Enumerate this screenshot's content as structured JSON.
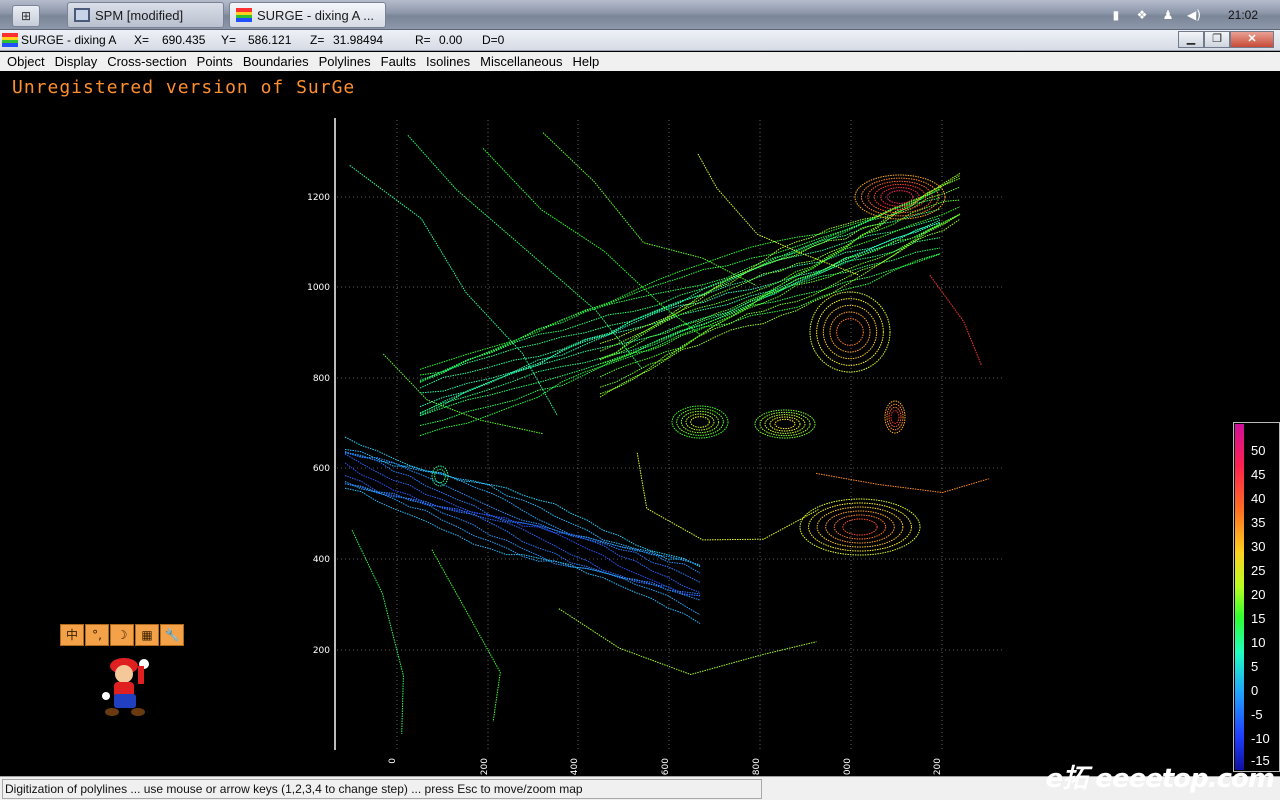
{
  "taskbar": {
    "tasks": [
      {
        "label": "SPM [modified]",
        "active": false
      },
      {
        "label": "SURGE - dixing A  ...",
        "active": true
      }
    ],
    "clock": "21:02"
  },
  "titlebar": {
    "app_name": "SURGE - dixing A",
    "x_label": "X=",
    "x_value": "690.435",
    "y_label": "Y=",
    "y_value": "586.121",
    "z_label": "Z=",
    "z_value": "31.98494",
    "r_label": "R=",
    "r_value": "0.00",
    "d_label": "D=0"
  },
  "menu": [
    "Object",
    "Display",
    "Cross-section",
    "Points",
    "Boundaries",
    "Polylines",
    "Faults",
    "Isolines",
    "Miscellaneous",
    "Help"
  ],
  "banner": "Unregistered version of SurGe",
  "axes": {
    "y_ticks": [
      "1200",
      "1000",
      "800",
      "600",
      "400",
      "200"
    ],
    "x_ticks": [
      "0",
      "200",
      "400",
      "600",
      "800",
      "1000",
      "1200"
    ]
  },
  "colorbar": {
    "labels": [
      "50",
      "45",
      "40",
      "35",
      "30",
      "25",
      "20",
      "15",
      "10",
      "5",
      "0",
      "-5",
      "-10",
      "-15"
    ]
  },
  "ime_bar": [
    "中",
    "°,",
    "☽",
    "▦",
    "🔧"
  ],
  "status": "Digitization of polylines ... use mouse or arrow keys (1,2,3,4 to change step) ... press Esc to move/zoom map",
  "watermark": "e拓 eeeetop.com"
}
